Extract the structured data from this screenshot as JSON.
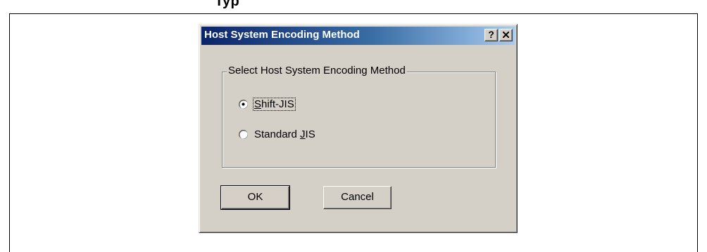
{
  "page": {
    "heading_fragment": "Typ"
  },
  "dialog": {
    "title": "Host System Encoding Method",
    "help_label": "?",
    "group_label": "Select Host System Encoding Method",
    "options": [
      {
        "pre": "",
        "accel": "S",
        "post": "hift-JIS",
        "selected": true
      },
      {
        "pre": "Standard ",
        "accel": "J",
        "post": "IS",
        "selected": false
      }
    ],
    "ok_label": "OK",
    "cancel_label": "Cancel"
  },
  "colors": {
    "face": "#d4d0c8",
    "title_start": "#0a246a",
    "title_end": "#a6caf0"
  },
  "icons": {
    "help": "question-mark-icon",
    "close": "close-icon"
  }
}
